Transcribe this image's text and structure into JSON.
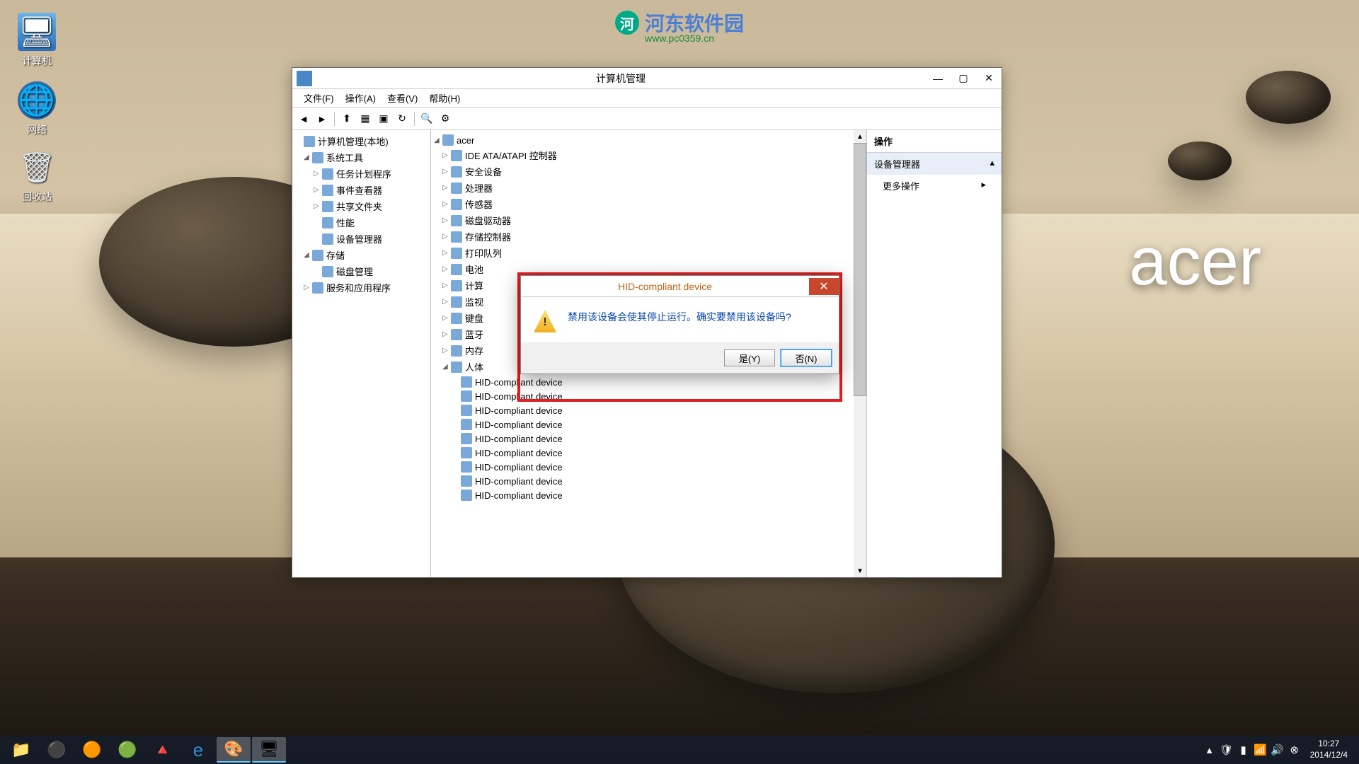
{
  "brand": "acer",
  "watermark": {
    "text": "河东软件园",
    "url": "www.pc0359.cn"
  },
  "desktop": {
    "computer": "计算机",
    "network": "网络",
    "recycle": "回收站"
  },
  "window": {
    "title": "计算机管理",
    "menu": [
      "文件(F)",
      "操作(A)",
      "查看(V)",
      "帮助(H)"
    ],
    "left_tree": [
      {
        "exp": "",
        "label": "计算机管理(本地)",
        "ind": 0
      },
      {
        "exp": "◢",
        "label": "系统工具",
        "ind": 1
      },
      {
        "exp": "▷",
        "label": "任务计划程序",
        "ind": 2
      },
      {
        "exp": "▷",
        "label": "事件查看器",
        "ind": 2
      },
      {
        "exp": "▷",
        "label": "共享文件夹",
        "ind": 2
      },
      {
        "exp": "",
        "label": "性能",
        "ind": 2
      },
      {
        "exp": "",
        "label": "设备管理器",
        "ind": 2
      },
      {
        "exp": "◢",
        "label": "存储",
        "ind": 1
      },
      {
        "exp": "",
        "label": "磁盘管理",
        "ind": 2
      },
      {
        "exp": "▷",
        "label": "服务和应用程序",
        "ind": 1
      }
    ],
    "mid_root": "acer",
    "mid_tree": [
      {
        "exp": "▷",
        "label": "IDE ATA/ATAPI 控制器"
      },
      {
        "exp": "▷",
        "label": "安全设备"
      },
      {
        "exp": "▷",
        "label": "处理器"
      },
      {
        "exp": "▷",
        "label": "传感器"
      },
      {
        "exp": "▷",
        "label": "磁盘驱动器"
      },
      {
        "exp": "▷",
        "label": "存储控制器"
      },
      {
        "exp": "▷",
        "label": "打印队列"
      },
      {
        "exp": "▷",
        "label": "电池"
      },
      {
        "exp": "▷",
        "label": "计算"
      },
      {
        "exp": "▷",
        "label": "监视"
      },
      {
        "exp": "▷",
        "label": "键盘"
      },
      {
        "exp": "▷",
        "label": "蓝牙"
      },
      {
        "exp": "▷",
        "label": "内存"
      },
      {
        "exp": "◢",
        "label": "人体"
      }
    ],
    "hid_items": [
      "HID-compliant device",
      "HID-compliant device",
      "HID-compliant device",
      "HID-compliant device",
      "HID-compliant device",
      "HID-compliant device",
      "HID-compliant device",
      "HID-compliant device",
      "HID-compliant device"
    ],
    "right": {
      "header": "操作",
      "section": "设备管理器",
      "item": "更多操作"
    }
  },
  "dialog": {
    "title": "HID-compliant device",
    "message": "禁用该设备会使其停止运行。确实要禁用该设备吗?",
    "yes": "是(Y)",
    "no": "否(N)"
  },
  "tray": {
    "time": "10:27",
    "date": "2014/12/4"
  }
}
